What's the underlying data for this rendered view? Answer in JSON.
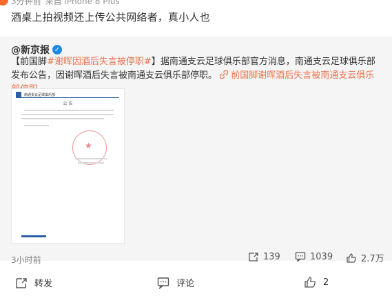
{
  "top": {
    "time": "3分钟前",
    "source": "来自 iPhone 8 Plus"
  },
  "post": {
    "text": "酒桌上拍视频还上传公共网络者，真小人也"
  },
  "repost": {
    "author": "@新京报",
    "body_prefix": "【前国脚",
    "topic": "#谢晖因酒后失言被停职#",
    "body_main": "】据南通支云足球俱乐部官方消息，南通支云足球俱乐部发布公告，因谢晖酒后失言被南通支云俱乐部停职。",
    "link": "前国脚谢晖酒后失言被南通支云俱乐部停职",
    "doc": {
      "org": "南通支云足球俱乐部",
      "title": "公 告"
    },
    "time": "3小时前",
    "stats": {
      "reposts": "139",
      "comments": "1039",
      "likes": "2.7万"
    }
  },
  "actions": {
    "repost_label": "转发",
    "comment_label": "评论",
    "like_count": "2"
  },
  "colors": {
    "accent": "#eb7350",
    "verified": "#1e88e5",
    "bg": "#f5f5f5"
  }
}
